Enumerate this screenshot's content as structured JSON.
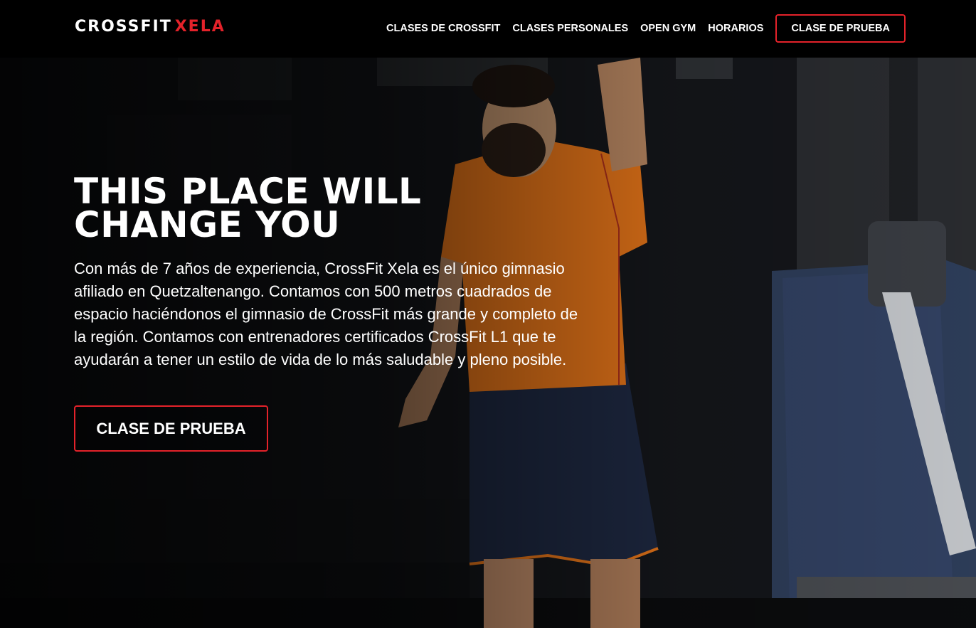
{
  "logo": {
    "part1": "CROSSFIT",
    "part2": "XELA"
  },
  "nav": {
    "items": [
      {
        "label": "CLASES DE CROSSFIT"
      },
      {
        "label": "CLASES PERSONALES"
      },
      {
        "label": "OPEN GYM"
      },
      {
        "label": "HORARIOS"
      }
    ],
    "cta_label": "CLASE DE PRUEBA"
  },
  "hero": {
    "headline_line1": "THIS PLACE WILL",
    "headline_line2": "CHANGE YOU",
    "description": "Con más de 7 años de experiencia, CrossFit Xela es el único gimnasio afiliado en Quetzaltenango. Contamos con 500 metros cuadrados de espacio haciéndonos el gimnasio de CrossFit más grande y completo de la región. Contamos con entrenadores certificados CrossFit L1 que te ayudarán a tener un estilo de vida de lo más saludable y pleno posible.",
    "cta_label": "CLASE DE PRUEBA"
  },
  "colors": {
    "accent": "#e4222a",
    "background": "#000000",
    "shirt": "#f07a1a",
    "shorts": "#1f2a44"
  }
}
